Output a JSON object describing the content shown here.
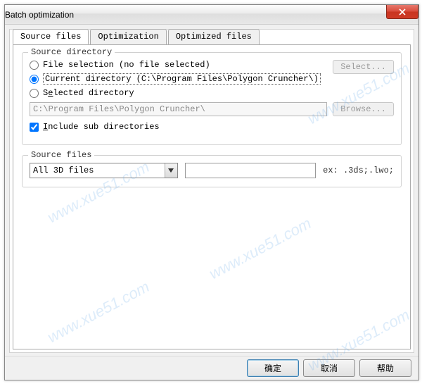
{
  "window": {
    "title": "Batch optimization"
  },
  "tabs": {
    "items": [
      {
        "label": "Source files",
        "active": true
      },
      {
        "label": "Optimization",
        "active": false
      },
      {
        "label": "Optimized files",
        "active": false
      }
    ]
  },
  "source_dir": {
    "legend": "Source directory",
    "radio_file_selection": "File selection (no file selected)",
    "radio_current_dir": "Current directory (C:\\Program Files\\Polygon Cruncher\\)",
    "radio_selected_dir_prefix": "S",
    "radio_selected_dir_underline": "e",
    "radio_selected_dir_suffix": "lected directory",
    "path_value": "C:\\Program Files\\Polygon Cruncher\\",
    "select_btn": "Select...",
    "browse_btn": "Browse...",
    "include_sub_prefix": "",
    "include_sub_underline": "I",
    "include_sub_suffix": "nclude sub directories",
    "selected_radio": "current"
  },
  "source_files": {
    "legend": "Source files",
    "combo_value": "All 3D files",
    "pattern_value": "",
    "example_label": "ex: .3ds;.lwo;"
  },
  "footer": {
    "ok": "确定",
    "cancel": "取消",
    "help": "帮助"
  },
  "watermark": "www.xue51.com"
}
